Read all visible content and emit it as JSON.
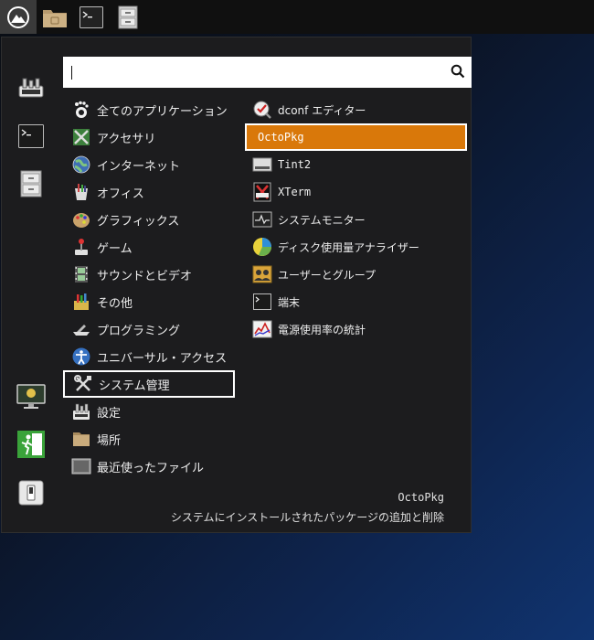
{
  "taskbar": {
    "items": [
      {
        "name": "start-menu-button",
        "icon": "mountain-logo-icon"
      },
      {
        "name": "file-manager-button",
        "icon": "folder-icon"
      },
      {
        "name": "terminal-button",
        "icon": "terminal-icon"
      },
      {
        "name": "archive-button",
        "icon": "file-cabinet-icon"
      }
    ]
  },
  "search": {
    "value": "",
    "placeholder": "",
    "icon": "search-icon"
  },
  "sidebar": {
    "items": [
      {
        "icon": "keyboard-settings-icon"
      },
      {
        "icon": "terminal-icon"
      },
      {
        "icon": "file-cabinet-icon"
      },
      {
        "icon": "monitor-lock-icon"
      },
      {
        "icon": "logout-exit-icon"
      },
      {
        "icon": "power-icon"
      }
    ]
  },
  "categories": [
    {
      "label": "全てのアプリケーション",
      "icon": "gnome-foot-icon"
    },
    {
      "label": "アクセサリ",
      "icon": "accessories-icon"
    },
    {
      "label": "インターネット",
      "icon": "globe-icon"
    },
    {
      "label": "オフィス",
      "icon": "office-icon"
    },
    {
      "label": "グラフィックス",
      "icon": "palette-icon"
    },
    {
      "label": "ゲーム",
      "icon": "joystick-icon"
    },
    {
      "label": "サウンドとビデオ",
      "icon": "film-strip-icon"
    },
    {
      "label": "その他",
      "icon": "misc-icon"
    },
    {
      "label": "プログラミング",
      "icon": "programming-icon"
    },
    {
      "label": "ユニバーサル・アクセス",
      "icon": "accessibility-icon"
    },
    {
      "label": "システム管理",
      "icon": "tools-icon"
    },
    {
      "label": "設定",
      "icon": "settings-icon"
    },
    {
      "label": "場所",
      "icon": "folder-icon"
    },
    {
      "label": "最近使ったファイル",
      "icon": "recent-files-icon"
    }
  ],
  "selected_category": "システム管理",
  "apps": [
    {
      "label": "dconf エディター",
      "icon": "dconf-editor-icon"
    },
    {
      "label": "OctoPkg",
      "icon": ""
    },
    {
      "label": "Tint2",
      "icon": "tint2-icon"
    },
    {
      "label": "XTerm",
      "icon": "xterm-icon"
    },
    {
      "label": "システムモニター",
      "icon": "system-monitor-icon"
    },
    {
      "label": "ディスク使用量アナライザー",
      "icon": "disk-usage-pie-icon"
    },
    {
      "label": "ユーザーとグループ",
      "icon": "users-groups-icon"
    },
    {
      "label": "端末",
      "icon": "terminal-icon"
    },
    {
      "label": "電源使用率の統計",
      "icon": "power-stats-icon"
    }
  ],
  "selected_app": "OctoPkg",
  "description": {
    "title": "OctoPkg",
    "text": "システムにインストールされたパッケージの追加と削除"
  },
  "colors": {
    "accent": "#d9780a",
    "panel": "#1c1c1e",
    "topbar": "#101010"
  }
}
